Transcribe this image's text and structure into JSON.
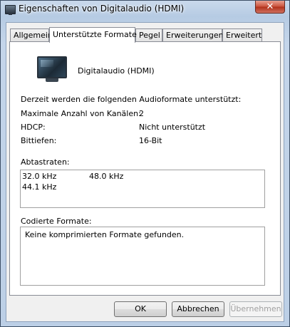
{
  "window": {
    "title": "Eigenschaften von Digitalaudio (HDMI)",
    "close_glyph": "✕"
  },
  "tabs": [
    {
      "label": "Allgemein"
    },
    {
      "label": "Unterstützte Formate"
    },
    {
      "label": "Pegel"
    },
    {
      "label": "Erweiterungen"
    },
    {
      "label": "Erweitert"
    }
  ],
  "active_tab": "Unterstützte Formate",
  "device": {
    "name": "Digitalaudio (HDMI)",
    "icon": "monitor-icon"
  },
  "formats": {
    "intro": "Derzeit werden die folgenden Audioformate unterstützt:",
    "rows": [
      {
        "label": "Maximale Anzahl von Kanälen:",
        "value": "2"
      },
      {
        "label": "HDCP:",
        "value": "Nicht unterstützt"
      },
      {
        "label": "Bittiefen:",
        "value": "16-Bit"
      }
    ]
  },
  "sample_rates": {
    "label": "Abtastraten:",
    "items": [
      "32.0 kHz",
      "48.0 kHz",
      "44.1 kHz"
    ]
  },
  "encoded": {
    "label": "Codierte Formate:",
    "text": "Keine komprimierten Formate gefunden."
  },
  "buttons": {
    "ok": "OK",
    "cancel": "Abbrechen",
    "apply": "Übernehmen"
  }
}
